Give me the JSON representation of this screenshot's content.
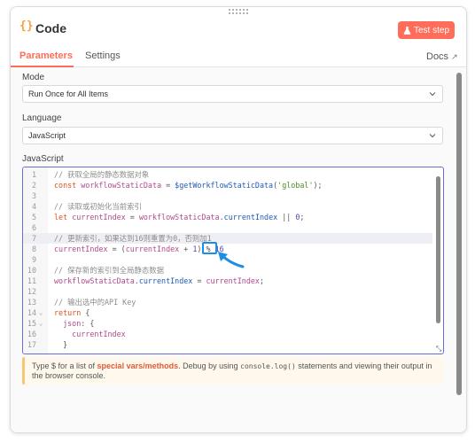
{
  "header": {
    "icon": "code-braces-icon",
    "title": "Code",
    "test_step_label": "Test step"
  },
  "tabs": {
    "parameters": "Parameters",
    "settings": "Settings",
    "docs": "Docs"
  },
  "mode": {
    "label": "Mode",
    "value": "Run Once for All Items"
  },
  "language": {
    "label": "Language",
    "value": "JavaScript"
  },
  "editor": {
    "label": "JavaScript",
    "lines": [
      {
        "n": "1",
        "fold": "",
        "code": "// 获取全局的静态数据对象"
      },
      {
        "n": "2",
        "fold": "",
        "code": "const workflowStaticData = $getWorkflowStaticData('global');"
      },
      {
        "n": "3",
        "fold": "",
        "code": ""
      },
      {
        "n": "4",
        "fold": "",
        "code": "// 读取或初始化当前索引"
      },
      {
        "n": "5",
        "fold": "",
        "code": "let currentIndex = workflowStaticData.currentIndex || 0;"
      },
      {
        "n": "6",
        "fold": "",
        "code": ""
      },
      {
        "n": "7",
        "fold": "",
        "code": "// 更新索引，如果达到16则重置为0，否则加1"
      },
      {
        "n": "8",
        "fold": "",
        "code": "currentIndex = (currentIndex + 1) % 16"
      },
      {
        "n": "9",
        "fold": "",
        "code": ""
      },
      {
        "n": "10",
        "fold": "",
        "code": "// 保存新的索引到全局静态数据"
      },
      {
        "n": "11",
        "fold": "",
        "code": "workflowStaticData.currentIndex = currentIndex;"
      },
      {
        "n": "12",
        "fold": "",
        "code": ""
      },
      {
        "n": "13",
        "fold": "",
        "code": "// 输出选中的API Key"
      },
      {
        "n": "14",
        "fold": "v",
        "code": "return {"
      },
      {
        "n": "15",
        "fold": "v",
        "code": "  json: {"
      },
      {
        "n": "16",
        "fold": "",
        "code": "    currentIndex"
      },
      {
        "n": "17",
        "fold": "",
        "code": "  }"
      }
    ]
  },
  "notice": {
    "part1": "Type $ for a list of ",
    "special": "special vars/methods",
    "part2": ". Debug by using ",
    "code": "console.log()",
    "part3": " statements and viewing their output in the browser console."
  },
  "colors": {
    "accent": "#ff6d5a",
    "highlight_box": "#1a8fe3",
    "editor_border": "#6b6bd6"
  }
}
